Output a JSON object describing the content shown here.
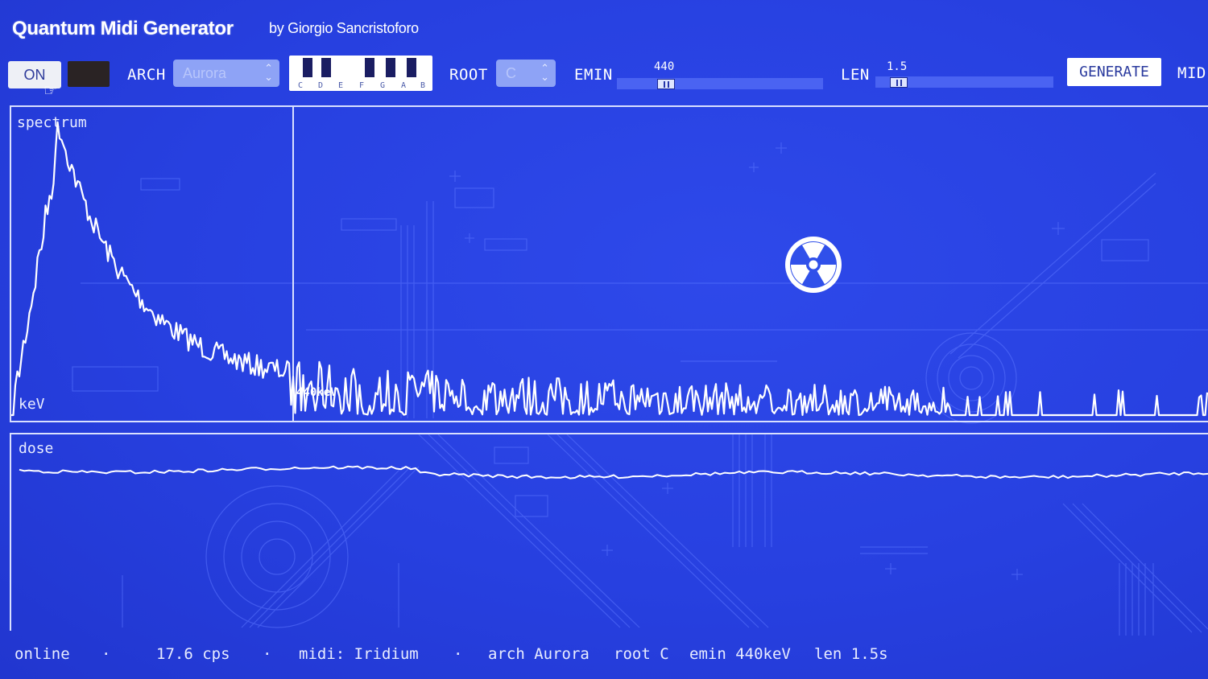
{
  "app": {
    "title": "Quantum Midi Generator",
    "byline": "by Giorgio Sancristoforo"
  },
  "toolbar": {
    "power_label": "ON",
    "arch_label": "ARCH",
    "arch_value": "Aurora",
    "keyboard_notes": [
      "C",
      "D",
      "E",
      "F",
      "G",
      "A",
      "B"
    ],
    "root_label": "ROOT",
    "root_value": "C",
    "emin_label": "EMIN",
    "emin_value": "440",
    "len_label": "LEN",
    "len_value": "1.5",
    "generate_label": "GENERATE",
    "midi_label": "MID"
  },
  "spectrum": {
    "label": "spectrum",
    "axis_label": "keV",
    "marker_label": "440keV"
  },
  "dose": {
    "label": "dose"
  },
  "status": {
    "connection": "online",
    "rate": "17.6 cps",
    "midi": "midi: Iridium",
    "arch": "arch Aurora",
    "root": "root C",
    "emin": "emin 440keV",
    "len": "len 1.5s",
    "sep": "·"
  },
  "icons": {
    "radiation": "radiation-icon",
    "cursor": "hand-cursor-icon"
  },
  "colors": {
    "background": "#2740e0",
    "line": "#ffffff",
    "panel_border": "#d9e0ff",
    "select_bg": "#8ea3f6"
  }
}
